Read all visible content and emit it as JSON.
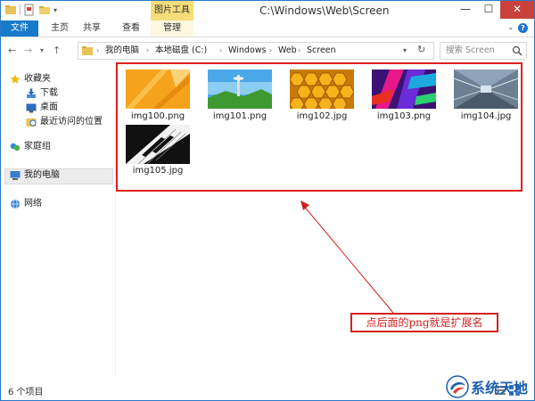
{
  "window": {
    "title": "C:\\Windows\\Web\\Screen",
    "context_tab": "图片工具",
    "controls": {
      "minimize": "—",
      "maximize": "☐",
      "close": "✕"
    }
  },
  "ribbon": {
    "tabs": [
      "文件",
      "主页",
      "共享",
      "查看",
      "管理"
    ],
    "help": "?"
  },
  "address": {
    "crumbs": [
      "我的电脑",
      "本地磁盘 (C:)",
      "Windows",
      "Web",
      "Screen"
    ],
    "search_placeholder": "搜索 Screen"
  },
  "nav_pane": {
    "items": [
      "收藏夹",
      "下载",
      "桌面",
      "最近访问的位置",
      "家庭组",
      "我的电脑",
      "网络"
    ]
  },
  "files": [
    {
      "name": "img100.png"
    },
    {
      "name": "img101.png"
    },
    {
      "name": "img102.jpg"
    },
    {
      "name": "img103.png"
    },
    {
      "name": "img104.jpg"
    },
    {
      "name": "img105.jpg"
    }
  ],
  "annotation": {
    "text": "点后面的png就是扩展名"
  },
  "status": {
    "count": "6 个项目"
  },
  "watermark": {
    "text": "系统天地",
    "brand_color": "#1d5fb0"
  },
  "colors": {
    "accent": "#1979ca",
    "highlight": "#e02020",
    "context_tab": "#f5dd7a"
  }
}
